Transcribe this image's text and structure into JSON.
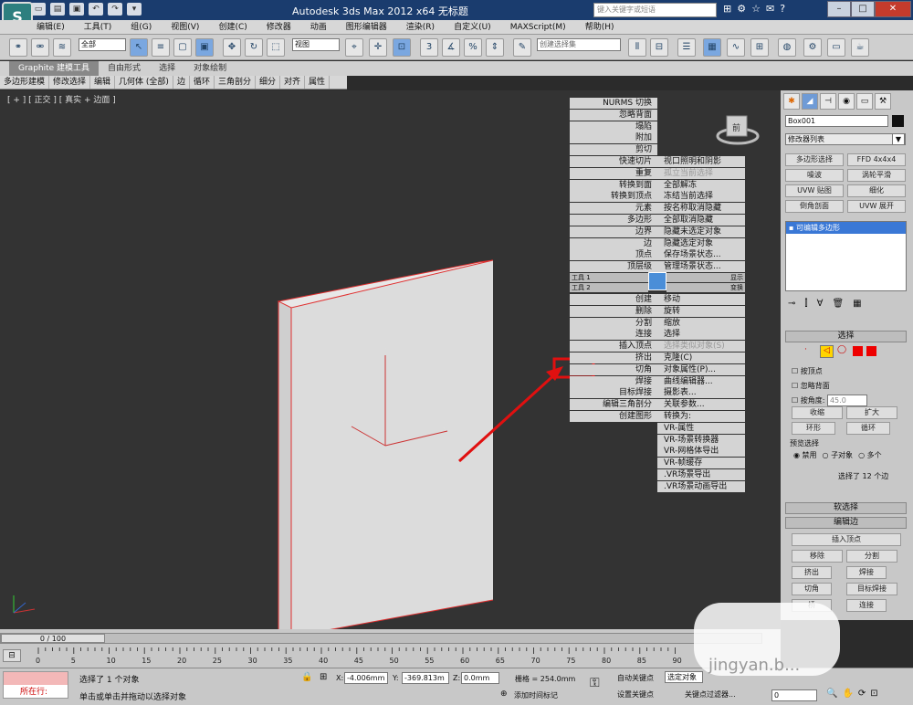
{
  "app": {
    "title": "Autodesk 3ds Max  2012 x64    无标题",
    "search_placeholder": "键入关键字或短语",
    "logo_text": "S"
  },
  "menu": [
    "编辑(E)",
    "工具(T)",
    "组(G)",
    "视图(V)",
    "创建(C)",
    "修改器",
    "动画",
    "图形编辑器",
    "渲染(R)",
    "自定义(U)",
    "MAXScript(M)",
    "帮助(H)"
  ],
  "toolbar": {
    "filter_value": "全部",
    "view_value": "视图",
    "selection_set_placeholder": "创建选择集",
    "snap_label": "3"
  },
  "ribbon": {
    "tabs": [
      "Graphite 建模工具",
      "自由形式",
      "选择",
      "对象绘制"
    ],
    "subtabs": [
      "多边形建模",
      "修改选择",
      "编辑",
      "几何体 (全部)",
      "边",
      "循环",
      "三角剖分",
      "细分",
      "对齐",
      "属性"
    ]
  },
  "viewport": {
    "label": "[ + ] [ 正交 ] [ 真实 + 边面 ]",
    "cube_label": "前",
    "axis_labels": {
      "x": "x",
      "y": "y",
      "z": "z"
    }
  },
  "quad_menu": {
    "left_items": [
      "NURMS 切换",
      "忽略背面",
      "塌陷",
      "附加",
      "剪切",
      "快速切片",
      "重复",
      "转换到面",
      "转换到顶点",
      "元素",
      "多边形",
      "边界",
      "边",
      "顶点",
      "顶层级",
      "创建",
      "删除",
      "分割",
      "连接",
      "插入顶点",
      "挤出",
      "切角",
      "焊接",
      "目标焊接",
      "编辑三角剖分",
      "创建图形"
    ],
    "right_items": [
      "视口照明和阴影",
      "孤立当前选择",
      "全部解冻",
      "冻结当前选择",
      "按名称取消隐藏",
      "全部取消隐藏",
      "隐藏未选定对象",
      "隐藏选定对象",
      "保存场景状态...",
      "管理场景状态...",
      "移动",
      "旋转",
      "缩放",
      "选择",
      "选择类似对象(S)",
      "克隆(C)",
      "对象属性(P)...",
      "曲线编辑器...",
      "摄影表...",
      "关联参数...",
      "转换为:",
      "VR-属性",
      "VR-场景转换器",
      "VR-网格体导出",
      "VR-帧缓存",
      ".VR场景导出",
      ".VR场景动画导出"
    ],
    "tool1": "工具 1",
    "tool2": "工具 2",
    "display": "显示",
    "transform": "变换"
  },
  "cmdpanel": {
    "object_name": "Box001",
    "modifier_list": "修改器列表",
    "buttons": [
      "多边形选择",
      "FFD 4x4x4",
      "噪波",
      "涡轮平滑",
      "UVW 贴图",
      "细化",
      "倒角剖面",
      "UVW 展开"
    ],
    "stack_item": "可编辑多边形",
    "rollout_select": "选择",
    "by_vertex": "按顶点",
    "ignore_backface": "忽略背面",
    "by_angle": "按角度:",
    "angle_value": "45.0",
    "shrink": "收缩",
    "grow": "扩大",
    "ring": "环形",
    "loop": "循环",
    "preview_selection": "预览选择",
    "preview_options": [
      "禁用",
      "子对象",
      "多个"
    ],
    "selected_info": "选择了 12 个边",
    "soft_selection": "软选择",
    "edit_edges": "编辑边",
    "insert_vertex": "插入顶点",
    "remove": "移除",
    "split": "分割",
    "extrude": "挤出",
    "weld": "焊接",
    "chamfer": "切角",
    "target_weld": "目标焊接",
    "bridge": "桥",
    "connect": "连接"
  },
  "timeline": {
    "frame": "0 / 100",
    "ticks": [
      "0",
      "5",
      "10",
      "15",
      "20",
      "25",
      "30",
      "35",
      "40",
      "45",
      "50",
      "55",
      "60",
      "65",
      "70",
      "75",
      "80",
      "85",
      "90"
    ]
  },
  "status": {
    "selected": "选择了 1 个对象",
    "hint": "单击或单击并拖动以选择对象",
    "x_label": "X:",
    "x_value": "-4.006mm",
    "y_label": "Y:",
    "y_value": "-369.813m",
    "z_label": "Z:",
    "z_value": "0.0mm",
    "grid": "栅格 = 254.0mm",
    "add_time_tag": "添加时间标记",
    "auto_key": "自动关键点",
    "selected_obj": "选定对象",
    "set_key": "设置关键点",
    "key_filter": "关键点过滤器...",
    "now_running": "所在行:",
    "frame_value": "0"
  },
  "watermark": "jingyan.b..."
}
